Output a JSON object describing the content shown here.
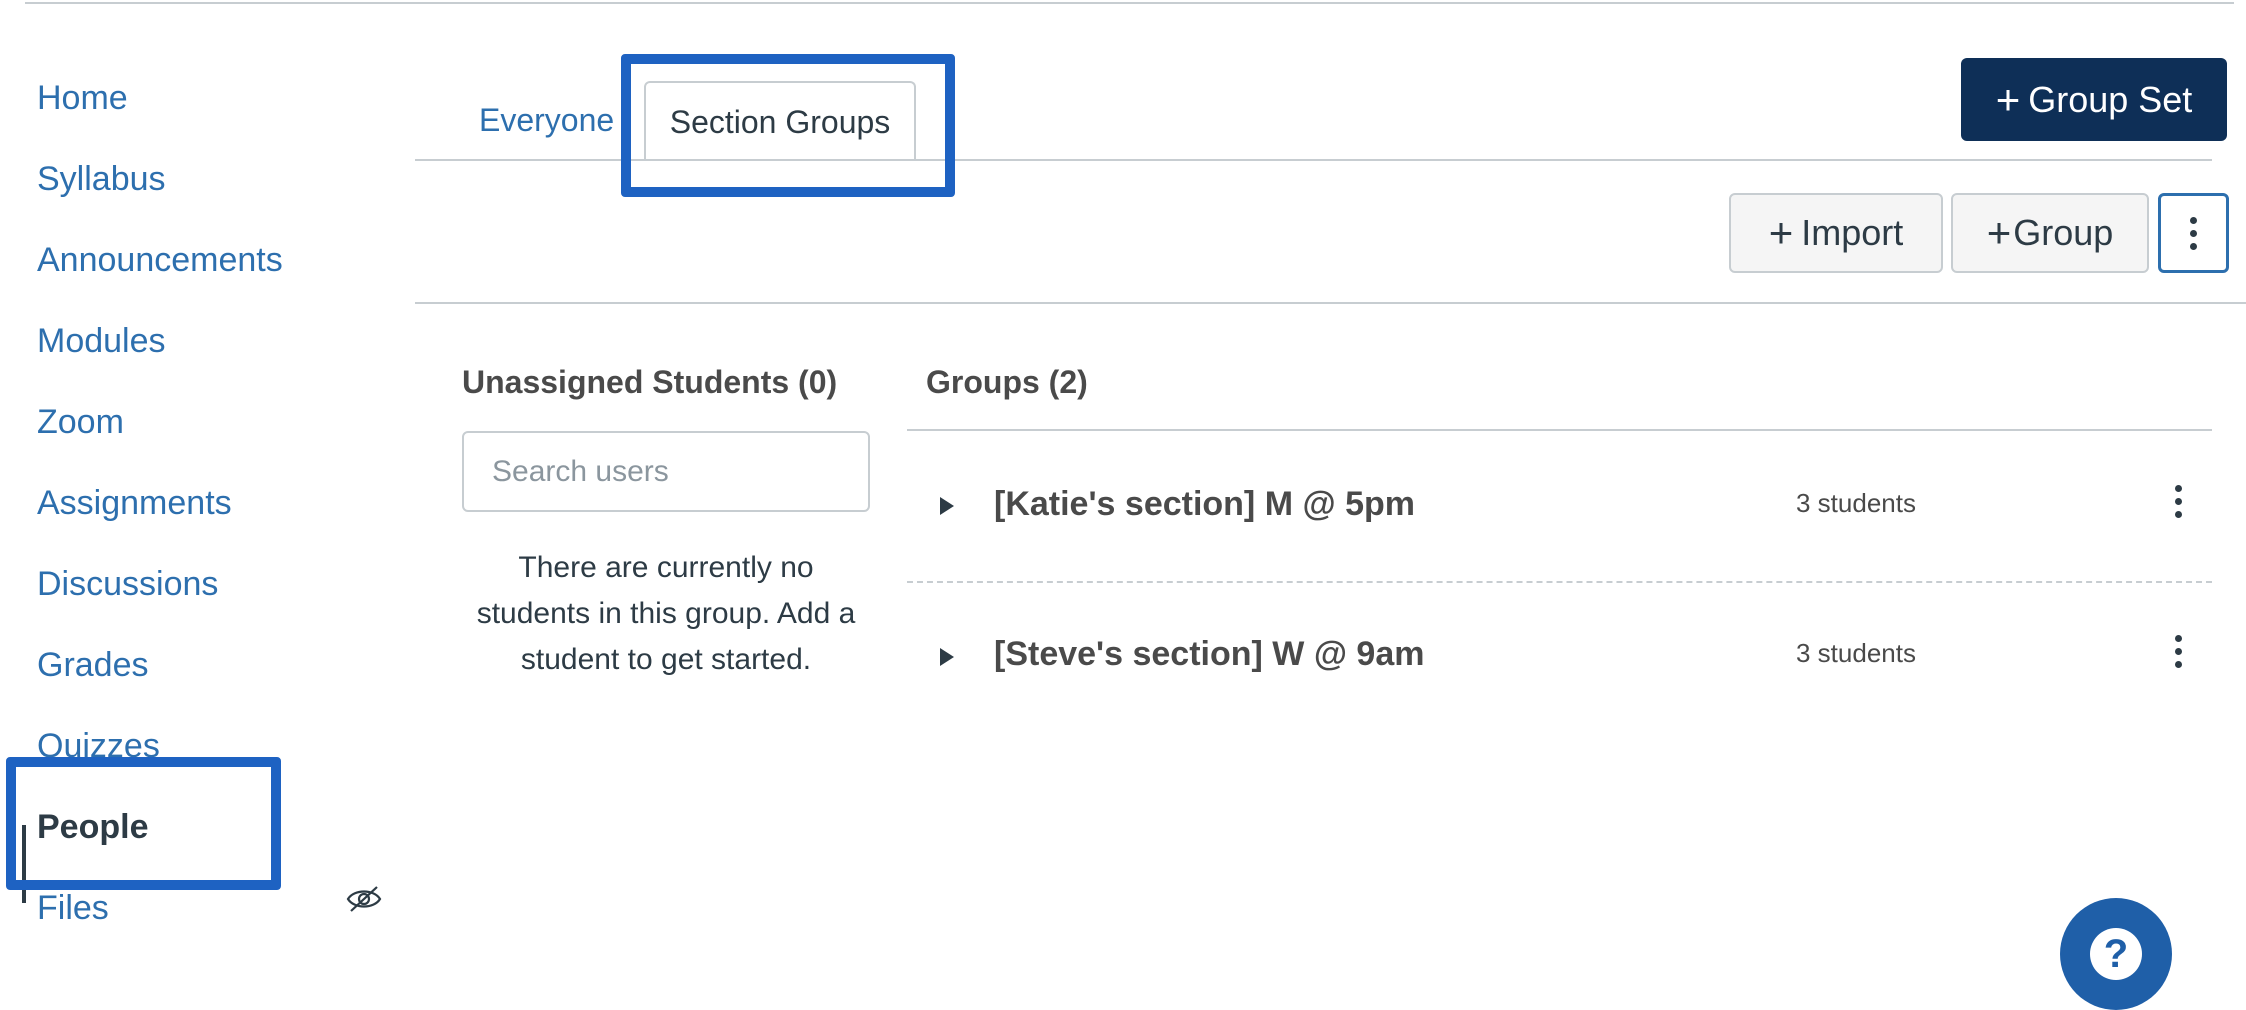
{
  "nav": {
    "items": [
      {
        "label": "Home"
      },
      {
        "label": "Syllabus"
      },
      {
        "label": "Announcements"
      },
      {
        "label": "Modules"
      },
      {
        "label": "Zoom"
      },
      {
        "label": "Assignments"
      },
      {
        "label": "Discussions"
      },
      {
        "label": "Grades"
      },
      {
        "label": "Quizzes"
      },
      {
        "label": "People",
        "active": true
      },
      {
        "label": "Files",
        "icon": "eye-slash-icon"
      }
    ]
  },
  "tabs": [
    {
      "label": "Everyone"
    },
    {
      "label": "Section Groups",
      "active": true
    }
  ],
  "toolbar": {
    "group_set_label": "Group Set",
    "import_label": "Import",
    "group_label": "Group",
    "more_icon": "kebab-menu-icon"
  },
  "unassigned": {
    "title": "Unassigned Students (0)",
    "search_placeholder": "Search users",
    "empty_message": "There are currently no students in this group. Add a student to get started."
  },
  "groups": {
    "title": "Groups (2)",
    "items": [
      {
        "name": "[Katie's section] M @ 5pm",
        "count": "3 students"
      },
      {
        "name": "[Steve's section] W @ 9am",
        "count": "3 students"
      }
    ]
  },
  "help": {
    "glyph": "?"
  },
  "colors": {
    "link": "#2d6fae",
    "primary_button": "#0e2f57",
    "highlight": "#1e62c2",
    "text": "#2d3b45"
  }
}
